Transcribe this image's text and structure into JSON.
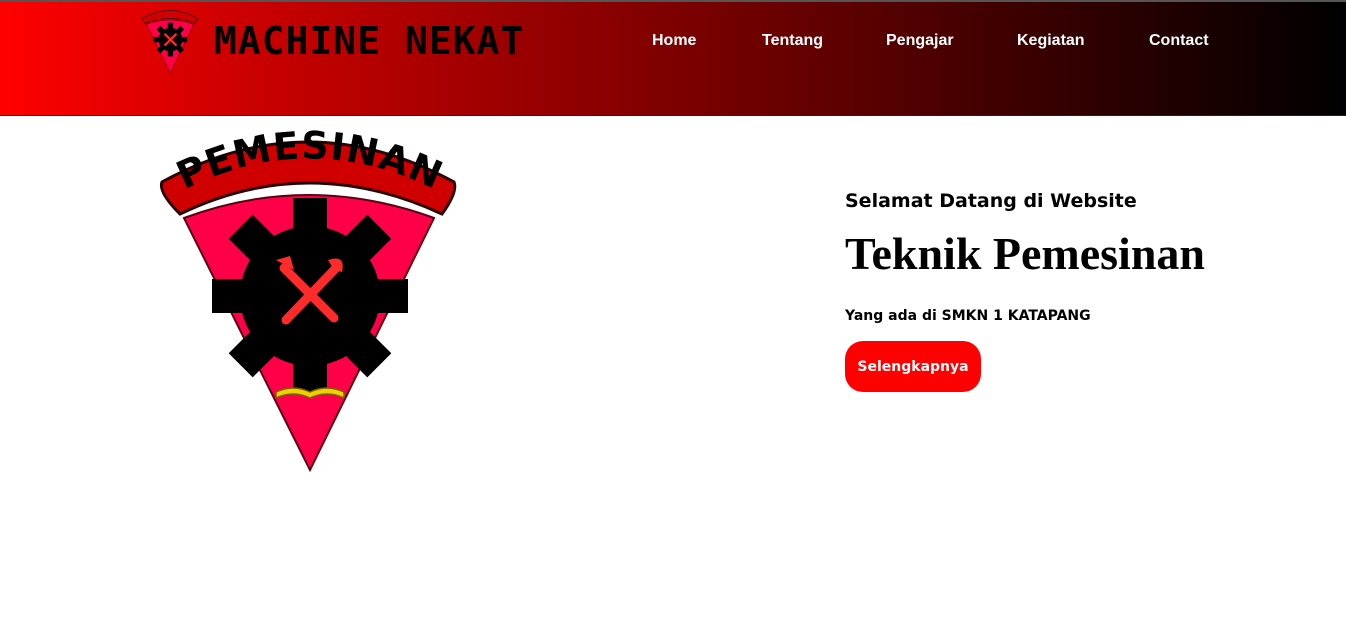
{
  "header": {
    "brand_title": "MACHINE NEKAT",
    "logo_text": "PEMESINAN",
    "gradient_colors": [
      "#ff0000",
      "#000000"
    ]
  },
  "nav": {
    "items": [
      {
        "label": "Home"
      },
      {
        "label": "Tentang"
      },
      {
        "label": "Pengajar"
      },
      {
        "label": "Kegiatan"
      },
      {
        "label": "Contact"
      }
    ]
  },
  "hero": {
    "logo_text": "PEMESINAN",
    "welcome": "Selamat Datang di Website",
    "headline": "Teknik Pemesinan",
    "subtext": "Yang ada di SMKN 1 KATAPANG",
    "button_label": "Selengkapnya",
    "accent_color": "#ff0000",
    "logo_colors": {
      "banner": "#d10000",
      "shield": "#ff0048",
      "gear": "#000000",
      "tools": "#ff2a2a",
      "book": "#f0d000"
    }
  }
}
